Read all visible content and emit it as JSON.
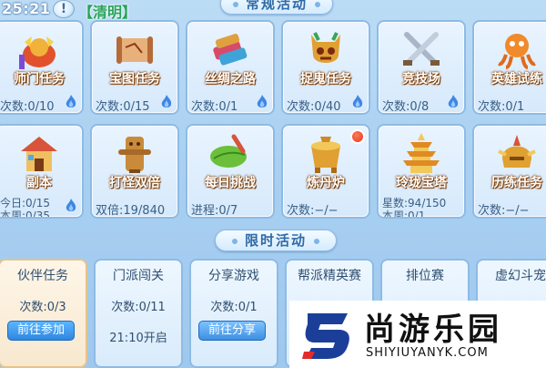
{
  "status": {
    "time": "25:21",
    "help": "!",
    "festival": "【清明】"
  },
  "sections": {
    "regular": "常规活动",
    "timed": "限时活动"
  },
  "regular": [
    {
      "name": "师门任务",
      "stat1": "次数:0/10",
      "stat2": "",
      "icon": "sect-crest-icon",
      "flame": true,
      "red_dot": false
    },
    {
      "name": "宝图任务",
      "stat1": "次数:0/15",
      "stat2": "",
      "icon": "treasure-map-icon",
      "flame": true,
      "red_dot": false
    },
    {
      "name": "丝绸之路",
      "stat1": "次数:0/1",
      "stat2": "",
      "icon": "silk-bundle-icon",
      "flame": true,
      "red_dot": false
    },
    {
      "name": "捉鬼任务",
      "stat1": "次数:0/40",
      "stat2": "",
      "icon": "ghost-mask-icon",
      "flame": true,
      "red_dot": false
    },
    {
      "name": "竞技场",
      "stat1": "次数:0/8",
      "stat2": "",
      "icon": "crossed-swords-icon",
      "flame": true,
      "red_dot": false
    },
    {
      "name": "英雄试练",
      "stat1": "次数:0/1",
      "stat2": "",
      "icon": "hero-octopus-icon",
      "flame": false,
      "red_dot": false
    },
    {
      "name": "副本",
      "stat1": "今日:0/15",
      "stat2": "本周:0/35",
      "icon": "dungeon-house-icon",
      "flame": true,
      "red_dot": false
    },
    {
      "name": "打怪双倍",
      "stat1": "双倍:19/840",
      "stat2": "",
      "icon": "wooden-dummy-icon",
      "flame": false,
      "red_dot": false
    },
    {
      "name": "每日挑战",
      "stat1": "进程:0/7",
      "stat2": "",
      "icon": "leaf-sword-icon",
      "flame": false,
      "red_dot": false
    },
    {
      "name": "炼丹炉",
      "stat1": "次数:−/−",
      "stat2": "",
      "icon": "alchemy-furnace-icon",
      "flame": false,
      "red_dot": true
    },
    {
      "name": "玲珑宝塔",
      "stat1": "星数:94/150",
      "stat2": "本周:0/1",
      "icon": "golden-pagoda-icon",
      "flame": false,
      "red_dot": false
    },
    {
      "name": "历练任务",
      "stat1": "次数:−/−",
      "stat2": "",
      "icon": "golden-helmet-icon",
      "flame": false,
      "red_dot": false
    }
  ],
  "timed": [
    {
      "name": "伙伴任务",
      "line1": "次数:0/3",
      "line2": "",
      "button": "前往参加"
    },
    {
      "name": "门派闯关",
      "line1": "次数:0/11",
      "line2": "21:10开启",
      "button": ""
    },
    {
      "name": "分享游戏",
      "line1": "次数:0/1",
      "line2": "",
      "button": "前往分享"
    },
    {
      "name": "帮派精英赛",
      "line1": "",
      "line2": "",
      "button": ""
    },
    {
      "name": "排位赛",
      "line1": "",
      "line2": "",
      "button": ""
    },
    {
      "name": "虚幻斗宠",
      "line1": "",
      "line2": "",
      "button": ""
    }
  ],
  "watermark": {
    "text": "尚游乐园",
    "url": "SHIYIUYANYK.COM"
  },
  "colors": {
    "accent_blue": "#2f86e0",
    "festival_green": "#27a35a",
    "flame_blue": "#3d86e6"
  }
}
